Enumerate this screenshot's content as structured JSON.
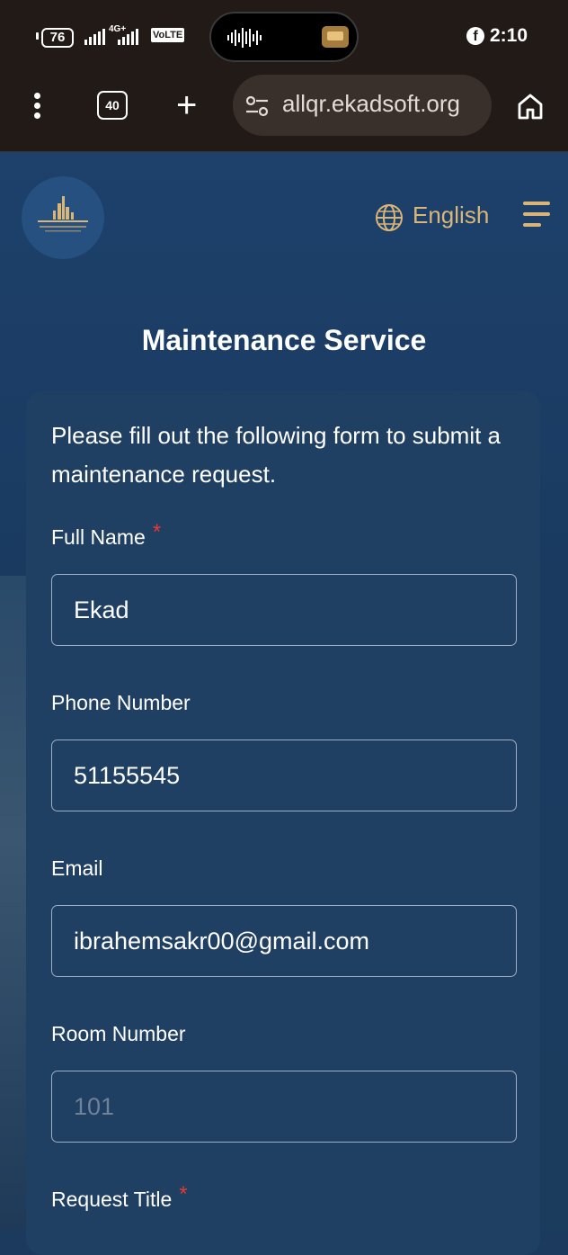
{
  "status_bar": {
    "battery": "76",
    "network": "4G+",
    "volte": "VoLTE",
    "time": "2:10",
    "facebook_glyph": "f"
  },
  "browser": {
    "tab_count": "40",
    "url": "allqr.ekadsoft.org"
  },
  "header": {
    "language": "English"
  },
  "page": {
    "title": "Maintenance Service",
    "intro": "Please fill out the following form to submit a maintenance request."
  },
  "form": {
    "required_marker": "*",
    "fields": [
      {
        "label": "Full Name",
        "value": "Ekad",
        "placeholder": "",
        "required": true
      },
      {
        "label": "Phone Number",
        "value": "51155545",
        "placeholder": "",
        "required": false
      },
      {
        "label": "Email",
        "value": "ibrahemsakr00@gmail.com",
        "placeholder": "",
        "required": false
      },
      {
        "label": "Room Number",
        "value": "",
        "placeholder": "101",
        "required": false
      },
      {
        "label": "Request Title",
        "value": "",
        "placeholder": "",
        "required": true
      }
    ]
  },
  "colors": {
    "accent": "#d9b678",
    "required": "#e53935",
    "background": "#1b3a5e"
  }
}
